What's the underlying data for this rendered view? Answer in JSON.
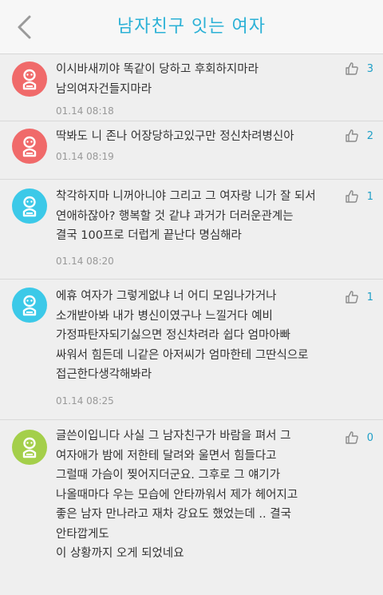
{
  "header": {
    "title": "남자친구 잇는 여자",
    "back_icon": "chevron-left-icon"
  },
  "colors": {
    "accent": "#2bb1d6",
    "avatar_red": "#f06a6a",
    "avatar_blue": "#3cc9e8",
    "avatar_green": "#a4cf4a"
  },
  "comments": [
    {
      "avatar_color": "#f06a6a",
      "text": "이시바새끼야 똑같이 당하고 후회하지마라\n남의여자건들지마라",
      "time": "01.14 08:18",
      "likes": "3"
    },
    {
      "avatar_color": "#f06a6a",
      "text": "딱봐도 니 존나 어장당하고있구만 정신차려병신아",
      "time": "01.14 08:19",
      "likes": "2"
    },
    {
      "avatar_color": "#3cc9e8",
      "text": "착각하지마 니꺼아니야 그리고 그 여자랑 니가 잘 되서\n연애하잖아?  행복할 것 같냐 과거가 더러운관계는\n결국 100프로 더럽게 끝난다 명심해라",
      "time": "01.14 08:20",
      "likes": "1"
    },
    {
      "avatar_color": "#3cc9e8",
      "text": "에휴 여자가 그렇게없냐  너  어디 모임나가거나\n소개받아봐 내가 병신이였구나 느낄거다 예비\n가정파탄자되기싫으면 정신차려라 쉽다 엄마아빠\n싸워서 힘든데 니같은 아저씨가 엄마한테 그딴식으로\n접근한다생각해봐라",
      "time": "01.14 08:25",
      "likes": "1"
    },
    {
      "avatar_color": "#a4cf4a",
      "text": "글쓴이입니다 사실 그 남자친구가 바람을 펴서 그\n여자애가  밤에 저한테 달려와  울면서 힘들다고\n그럴때 가슴이 찢어지더군요. 그후로 그 얘기가\n나올때마다 우는 모습에 안타까워서  제가 헤어지고\n좋은 남자 만나라고 재차 강요도 했었는데 .. 결국\n안타깝게도\n이 상황까지 오게 되었네요",
      "time": "",
      "likes": "0"
    }
  ]
}
